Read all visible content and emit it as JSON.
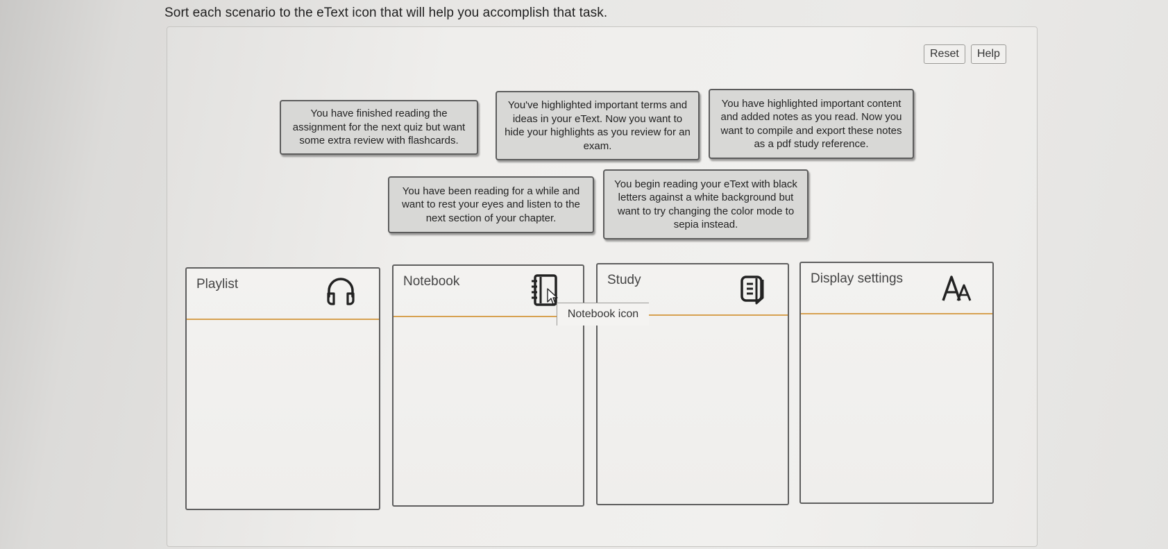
{
  "instruction": "Sort each scenario to the eText icon that will help you accomplish that task.",
  "toolbar": {
    "reset_label": "Reset",
    "help_label": "Help"
  },
  "cards": [
    "You have finished reading the assignment for the next quiz but want some extra review with flashcards.",
    "You've highlighted important terms and ideas in your eText. Now you want to hide your highlights as you review for an exam.",
    "You have highlighted important content and added notes as you read. Now you want to compile and export these notes as a pdf study reference.",
    "You have been reading for a while and want to rest your eyes and listen to the next section of your chapter.",
    "You begin reading your eText with black letters against a white background but want to try changing the color mode to sepia instead."
  ],
  "bins": [
    {
      "label": "Playlist",
      "icon": "headphones-icon"
    },
    {
      "label": "Notebook",
      "icon": "notebook-icon"
    },
    {
      "label": "Study",
      "icon": "study-icon"
    },
    {
      "label": "Display settings",
      "icon": "font-size-icon"
    }
  ],
  "tooltip": "Notebook icon",
  "colors": {
    "header_divider": "#d7a150",
    "card_bg": "#d8d8d6"
  }
}
